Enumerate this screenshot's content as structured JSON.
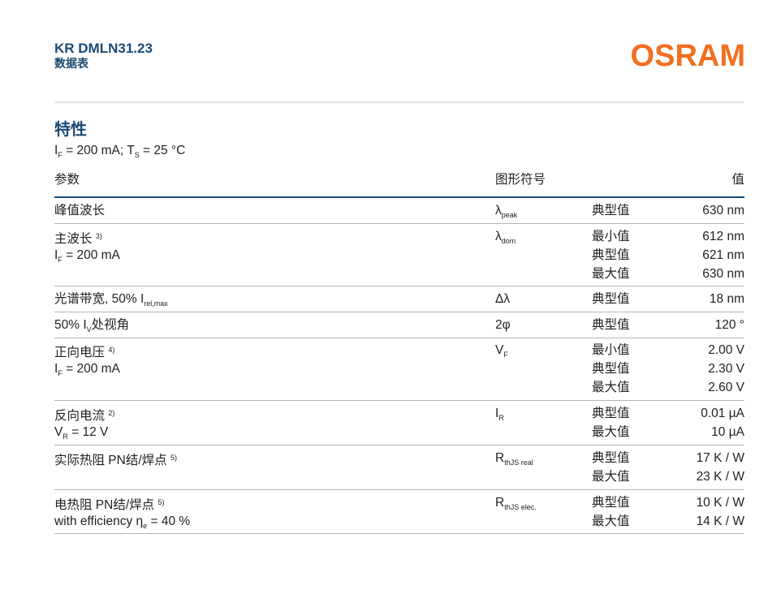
{
  "header": {
    "doc_id": "KR DMLN31.23",
    "doc_type": "数据表",
    "brand": "OSRAM"
  },
  "section": {
    "title": "特性",
    "conditions": {
      "if_sym": "I",
      "if_sub": "F",
      "if_val": " = 200 mA; T",
      "ts_sub": "S",
      "ts_val": " = 25 °C"
    }
  },
  "columns": {
    "param": "参数",
    "symbol": "图形符号",
    "value": "值"
  },
  "rows": {
    "peak": {
      "name": "峰值波长",
      "sym": "λ",
      "sym_sub": "peak",
      "type1": "典型值",
      "val1": "630 nm"
    },
    "dom": {
      "name": "主波长",
      "note": "3)",
      "cond_sym": "I",
      "cond_sub": "F",
      "cond_val": " = 200 mA",
      "sym": "λ",
      "sym_sub": "dom",
      "type1": "最小值",
      "val1": "612 nm",
      "type2": "典型值",
      "val2": "621 nm",
      "type3": "最大值",
      "val3": "630 nm"
    },
    "bw": {
      "name": "光谱带宽, 50% I",
      "name_sub": "rel,max",
      "sym": "Δλ",
      "type1": "典型值",
      "val1": "18 nm"
    },
    "angle": {
      "name_pre": "50% I",
      "name_sub": "V",
      "name_post": "处视角",
      "sym": "2φ",
      "type1": "典型值",
      "val1": "120 °"
    },
    "vf": {
      "name": "正向电压",
      "note": "4)",
      "cond_sym": "I",
      "cond_sub": "F",
      "cond_val": " = 200 mA",
      "sym": "V",
      "sym_sub": "F",
      "type1": "最小值",
      "val1": "2.00 V",
      "type2": "典型值",
      "val2": "2.30 V",
      "type3": "最大值",
      "val3": "2.60 V"
    },
    "ir": {
      "name": "反向电流",
      "note": "2)",
      "cond_sym": "V",
      "cond_sub": "R",
      "cond_val": " = 12 V",
      "sym": "I",
      "sym_sub": "R",
      "type1": "典型值",
      "val1": "0.01 µA",
      "type2": "最大值",
      "val2": "10 µA"
    },
    "rth_real": {
      "name": "实际热阻 PN结/焊点",
      "note": "5)",
      "sym": "R",
      "sym_sub": "thJS real",
      "type1": "典型值",
      "val1": "17 K / W",
      "type2": "最大值",
      "val2": "23 K / W"
    },
    "rth_elec": {
      "name": "电热阻 PN结/焊点",
      "note": "5)",
      "cond_pre": "with efficiency η",
      "cond_sub": "e",
      "cond_val": " = 40 %",
      "sym": "R",
      "sym_sub": "thJS elec.",
      "type1": "典型值",
      "val1": "10 K / W",
      "type2": "最大值",
      "val2": "14 K / W"
    }
  },
  "colors": {
    "heading": "#1a4b73",
    "brand": "#f26f21",
    "rule": "#b5b5b5"
  }
}
